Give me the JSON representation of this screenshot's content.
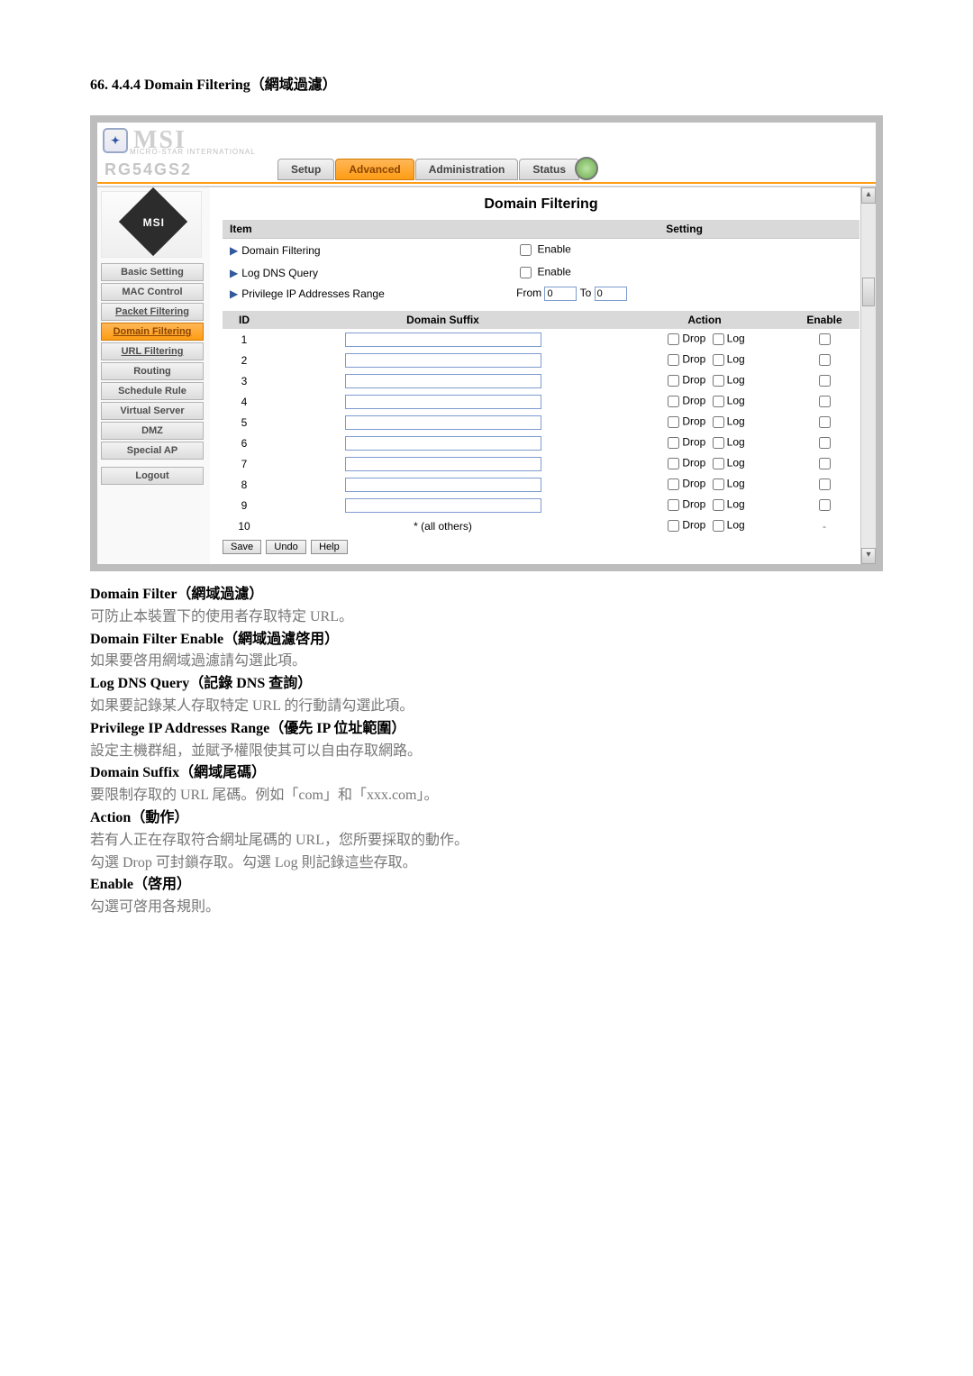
{
  "doc": {
    "section_heading": "66.   4.4.4 Domain Filtering（網域過濾）"
  },
  "device": {
    "brand": "MSI",
    "brand_sub": "MICRO-STAR INTERNATIONAL",
    "model": "RG54GS2"
  },
  "tabs": {
    "setup": "Setup",
    "advanced": "Advanced",
    "administration": "Administration",
    "status": "Status"
  },
  "sidebar": {
    "items": [
      {
        "key": "basic-setting",
        "label": "Basic Setting"
      },
      {
        "key": "mac-control",
        "label": "MAC Control"
      },
      {
        "key": "packet-filtering",
        "label": "Packet Filtering"
      },
      {
        "key": "domain-filtering",
        "label": "Domain Filtering"
      },
      {
        "key": "url-filtering",
        "label": "URL Filtering"
      },
      {
        "key": "routing",
        "label": "Routing"
      },
      {
        "key": "schedule-rule",
        "label": "Schedule Rule"
      },
      {
        "key": "virtual-server",
        "label": "Virtual Server"
      },
      {
        "key": "dmz",
        "label": "DMZ"
      },
      {
        "key": "special-ap",
        "label": "Special AP"
      }
    ],
    "logout": "Logout"
  },
  "content": {
    "title": "Domain Filtering",
    "item_header": "Item",
    "setting_header": "Setting",
    "rows": {
      "domain_filtering": "Domain Filtering",
      "log_dns_query": "Log DNS Query",
      "privilege_range": "Privilege IP Addresses Range",
      "enable": "Enable",
      "from": "From",
      "to": "To",
      "from_val": "0",
      "to_val": "0"
    },
    "rules_header": {
      "id": "ID",
      "domain_suffix": "Domain Suffix",
      "action": "Action",
      "enable": "Enable"
    },
    "action_labels": {
      "drop": "Drop",
      "log": "Log"
    },
    "rules": [
      {
        "id": "1",
        "suffix": "",
        "all_others": false
      },
      {
        "id": "2",
        "suffix": "",
        "all_others": false
      },
      {
        "id": "3",
        "suffix": "",
        "all_others": false
      },
      {
        "id": "4",
        "suffix": "",
        "all_others": false
      },
      {
        "id": "5",
        "suffix": "",
        "all_others": false
      },
      {
        "id": "6",
        "suffix": "",
        "all_others": false
      },
      {
        "id": "7",
        "suffix": "",
        "all_others": false
      },
      {
        "id": "8",
        "suffix": "",
        "all_others": false
      },
      {
        "id": "9",
        "suffix": "",
        "all_others": false
      },
      {
        "id": "10",
        "suffix": "* (all others)",
        "all_others": true
      }
    ],
    "buttons": {
      "save": "Save",
      "undo": "Undo",
      "help": "Help"
    }
  },
  "desc": {
    "p1_title": "Domain Filter（網域過濾）",
    "p1_body": "可防止本裝置下的使用者存取特定 URL。",
    "p2_title": "Domain Filter Enable（網域過濾啓用）",
    "p2_body": "如果要啓用網域過濾請勾選此項。",
    "p3_title": "Log DNS Query（記錄 DNS 查詢）",
    "p3_body": "如果要記錄某人存取特定 URL 的行動請勾選此項。",
    "p4_title": "Privilege IP Addresses Range（優先 IP 位址範圍）",
    "p4_body": "設定主機群組，並賦予權限使其可以自由存取網路。",
    "p5_title": "Domain Suffix（網域尾碼）",
    "p5_body": "要限制存取的 URL 尾碼。例如「com」和「xxx.com」。",
    "p6_title": "Action（動作）",
    "p6_body1": "若有人正在存取符合網址尾碼的 URL，您所要採取的動作。",
    "p6_body2": "勾選 Drop 可封鎖存取。勾選 Log 則記錄這些存取。",
    "p7_title": "Enable（啓用）",
    "p7_body": "勾選可啓用各規則。"
  }
}
